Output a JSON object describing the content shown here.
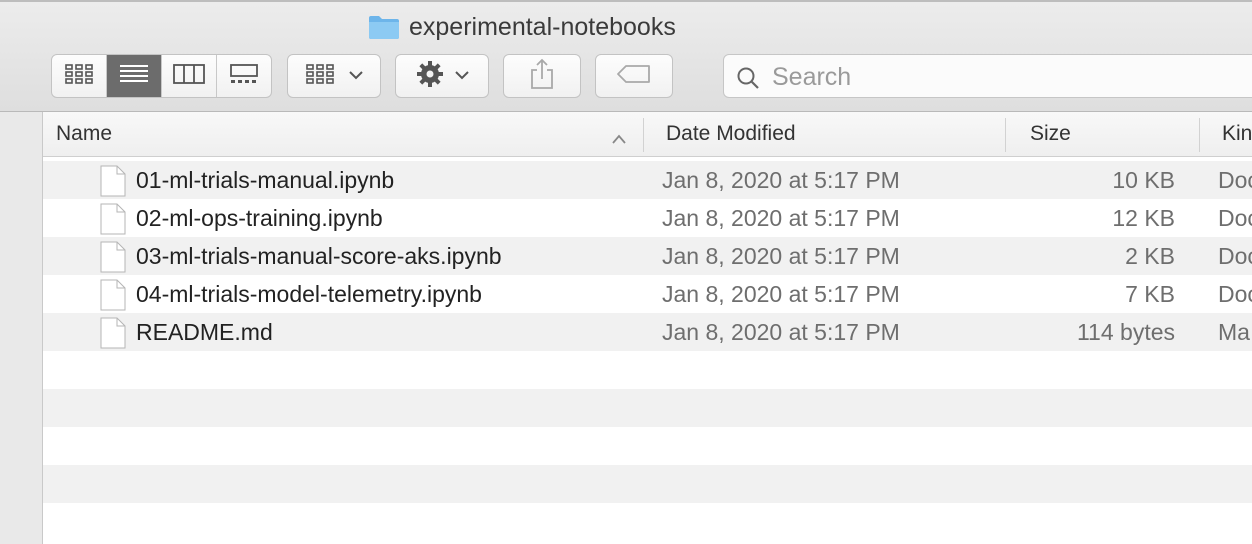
{
  "window": {
    "title": "experimental-notebooks",
    "folder_color": "#7cc0f0"
  },
  "toolbar": {
    "view_modes": [
      {
        "name": "icon-view",
        "active": false
      },
      {
        "name": "list-view",
        "active": true
      },
      {
        "name": "column-view",
        "active": false
      },
      {
        "name": "gallery-view",
        "active": false
      }
    ],
    "icons": [
      "grid-icon",
      "list-icon",
      "columns-icon",
      "gallery-icon",
      "group-by-icon",
      "gear-icon",
      "share-icon",
      "tag-icon",
      "search-icon"
    ],
    "search_placeholder": "Search"
  },
  "columns": {
    "name": "Name",
    "date_modified": "Date Modified",
    "size": "Size",
    "kind": "Kin"
  },
  "files": [
    {
      "name": "01-ml-trials-manual.ipynb",
      "date": "Jan 8, 2020 at 5:17 PM",
      "size": "10 KB",
      "kind": "Doc"
    },
    {
      "name": "02-ml-ops-training.ipynb",
      "date": "Jan 8, 2020 at 5:17 PM",
      "size": "12 KB",
      "kind": "Doc"
    },
    {
      "name": "03-ml-trials-manual-score-aks.ipynb",
      "date": "Jan 8, 2020 at 5:17 PM",
      "size": "2 KB",
      "kind": "Doc"
    },
    {
      "name": "04-ml-trials-model-telemetry.ipynb",
      "date": "Jan 8, 2020 at 5:17 PM",
      "size": "7 KB",
      "kind": "Doc"
    },
    {
      "name": "README.md",
      "date": "Jan 8, 2020 at 5:17 PM",
      "size": "114 bytes",
      "kind": "Ma"
    }
  ],
  "colors": {
    "row_stripe": "#f1f1f1",
    "active_segment": "#6c6c6c"
  }
}
